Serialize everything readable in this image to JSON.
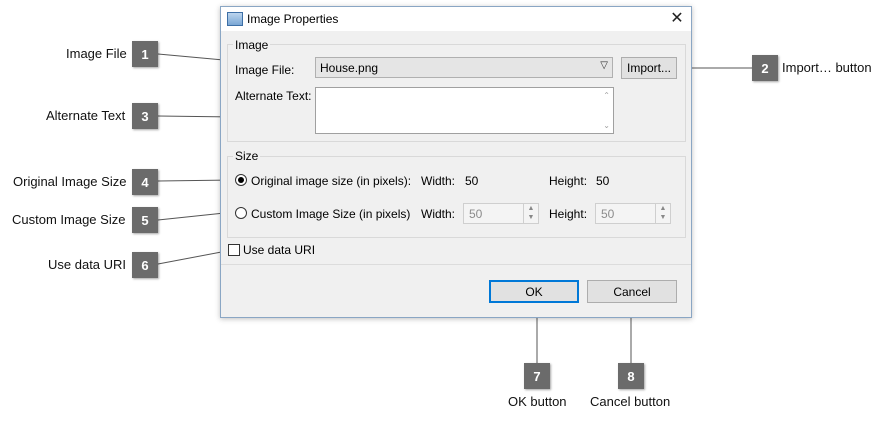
{
  "dialog": {
    "title": "Image Properties",
    "image_group": {
      "label": "Image",
      "image_file_label": "Image File:",
      "image_file_value": "House.png",
      "import_button": "Import...",
      "alternate_text_label": "Alternate Text:",
      "alternate_text_value": ""
    },
    "size_group": {
      "label": "Size",
      "original_radio_label": "Original image size (in pixels):",
      "original_selected": true,
      "original_width_label": "Width:",
      "original_width_value": "50",
      "original_height_label": "Height:",
      "original_height_value": "50",
      "custom_radio_label": "Custom Image Size (in pixels)",
      "custom_width_label": "Width:",
      "custom_width_value": "50",
      "custom_height_label": "Height:",
      "custom_height_value": "50"
    },
    "use_data_uri_label": "Use data URI",
    "use_data_uri_checked": false,
    "ok_button": "OK",
    "cancel_button": "Cancel"
  },
  "callouts": [
    {
      "number": "1",
      "label": "Image File"
    },
    {
      "number": "2",
      "label": "Import… button"
    },
    {
      "number": "3",
      "label": "Alternate Text"
    },
    {
      "number": "4",
      "label": "Original Image Size"
    },
    {
      "number": "5",
      "label": "Custom Image Size"
    },
    {
      "number": "6",
      "label": "Use data URI"
    },
    {
      "number": "7",
      "label": "OK button"
    },
    {
      "number": "8",
      "label": "Cancel button"
    }
  ],
  "colors": {
    "badge": "#6b6b6b",
    "dialog_bg": "#f0f0f0",
    "default_button_border": "#0078d7"
  }
}
